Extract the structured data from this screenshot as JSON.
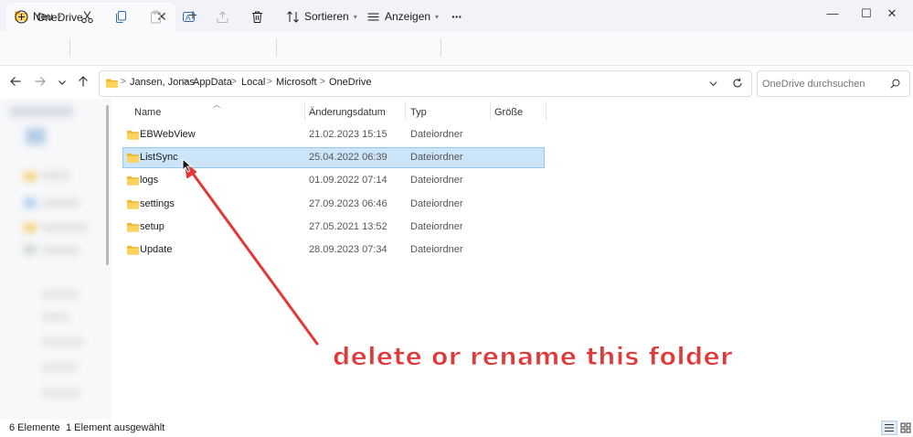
{
  "window": {
    "tab_title": "OneDrive",
    "new_tab": "+",
    "minimize": "—",
    "maximize": "☐",
    "close": "✕",
    "tab_close": "✕"
  },
  "toolbar": {
    "new_label": "Neu",
    "sort_label": "Sortieren",
    "view_label": "Anzeigen",
    "more_label": "···"
  },
  "address": {
    "breadcrumbs": [
      "Jansen, Jonas",
      "AppData",
      "Local",
      "Microsoft",
      "OneDrive"
    ],
    "separator": ">"
  },
  "search": {
    "placeholder": "OneDrive durchsuchen"
  },
  "columns": {
    "name": "Name",
    "date": "Änderungsdatum",
    "type": "Typ",
    "size": "Größe"
  },
  "files": [
    {
      "name": "EBWebView",
      "date": "21.02.2023 15:15",
      "type": "Dateiordner",
      "selected": false
    },
    {
      "name": "ListSync",
      "date": "25.04.2022 06:39",
      "type": "Dateiordner",
      "selected": true
    },
    {
      "name": "logs",
      "date": "01.09.2022 07:14",
      "type": "Dateiordner",
      "selected": false
    },
    {
      "name": "settings",
      "date": "27.09.2023 06:46",
      "type": "Dateiordner",
      "selected": false
    },
    {
      "name": "setup",
      "date": "27.05.2021 13:52",
      "type": "Dateiordner",
      "selected": false
    },
    {
      "name": "Update",
      "date": "28.09.2023 07:34",
      "type": "Dateiordner",
      "selected": false
    }
  ],
  "annotation": {
    "text": "delete or rename this folder",
    "color": "#e33838"
  },
  "status": {
    "count": "6 Elemente",
    "selection": "1 Element ausgewählt"
  },
  "colors": {
    "selection_bg": "#cce4f7",
    "selection_border": "#99c9ef",
    "folder_yellow": "#f8c844"
  }
}
